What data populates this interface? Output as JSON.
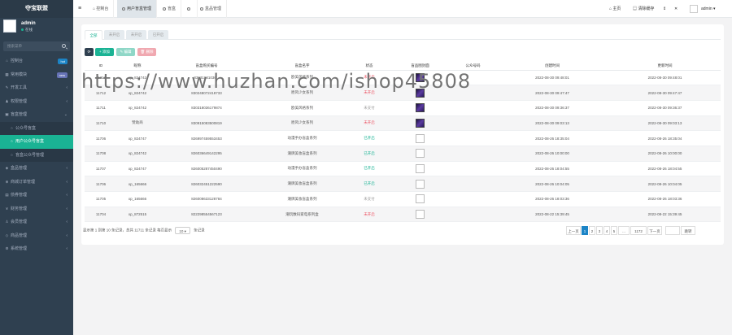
{
  "app": {
    "logo": "夺宝联盟"
  },
  "user": {
    "name": "admin",
    "status": "在线"
  },
  "search": {
    "placeholder": "搜索菜单"
  },
  "sidebar": {
    "items": [
      {
        "label": "控制台",
        "icon": "home-icon",
        "badge": "hot",
        "badge_color": "#1c84c6"
      },
      {
        "label": "常用模块",
        "icon": "table-icon",
        "badge": "new",
        "badge_color": "#6673b6"
      },
      {
        "label": "开发工具",
        "icon": "tool-icon"
      },
      {
        "label": "权限管理",
        "icon": "users-icon"
      },
      {
        "label": "盲盒管理",
        "icon": "box-icon"
      },
      {
        "label": "公众号盲盒",
        "sub": true
      },
      {
        "label": "用户公众号盲盒",
        "sub": true,
        "active": true
      },
      {
        "label": "盲盒公众号管理",
        "sub": true
      },
      {
        "label": "盒品管理",
        "icon": "cube-icon"
      },
      {
        "label": "商城订单管理",
        "icon": "cart-icon"
      },
      {
        "label": "债券管理",
        "icon": "doc-icon"
      },
      {
        "label": "财务管理",
        "icon": "money-icon"
      },
      {
        "label": "会员管理",
        "icon": "user-icon"
      },
      {
        "label": "商品管理",
        "icon": "tag-icon"
      },
      {
        "label": "系统管理",
        "icon": "gear-icon"
      }
    ]
  },
  "topbar": {
    "tabs": [
      "控制台",
      "用户盲盒管理",
      "盲盒",
      "",
      "盒品管理"
    ],
    "right": {
      "home": "主页",
      "clear_cache": "清除缓存",
      "user": "admin"
    }
  },
  "filters": {
    "tabs": [
      "全部",
      "未开启",
      "未开启",
      "已开启"
    ]
  },
  "toolbar": {
    "refresh": "⟳",
    "add": "+ 添加",
    "edit": "✎ 编辑",
    "delete": "🗑 删除"
  },
  "table": {
    "columns": [
      "ID",
      "昵称",
      "盲盒购买编号",
      "盲盒名字",
      "状态",
      "盲品图封面",
      "公众号码",
      "创建时间",
      "更新时间"
    ],
    "rows": [
      {
        "id": "11713",
        "nick": "xp_824742",
        "code": "83031881036...",
        "name": "欧美风格系列",
        "status": "未开启",
        "sc": "red",
        "img": "img",
        "num": "",
        "created": "2022-08-30 09:48:01",
        "updated": "2022-08-30 09:48:01"
      },
      {
        "id": "11712",
        "nick": "xp_824742",
        "code": "830248072418733",
        "name": "原风少女系列",
        "status": "未开启",
        "sc": "red",
        "img": "img",
        "num": "",
        "created": "2022-08-30 09:47:47",
        "updated": "2022-08-30 09:47:47"
      },
      {
        "id": "11711",
        "nick": "xp_824742",
        "code": "830318036179874",
        "name": "欧美风格系列",
        "status": "未支付",
        "sc": "gray",
        "img": "img",
        "num": "",
        "created": "2022-08-30 09:36:37",
        "updated": "2022-08-30 09:36:37"
      },
      {
        "id": "11710",
        "nick": "赞助商",
        "code": "830915083500819",
        "name": "原风少女系列",
        "status": "未开启",
        "sc": "red",
        "img": "img",
        "num": "",
        "created": "2022-08-30 09:03:13",
        "updated": "2022-08-30 09:03:13"
      },
      {
        "id": "11706",
        "nick": "xp_824747",
        "code": "826997459553453",
        "name": "动漫手办盲盒系列",
        "status": "已开启",
        "sc": "green",
        "img": "broken",
        "num": "",
        "created": "2022-08-26 18:35:04",
        "updated": "2022-08-26 18:35:04"
      },
      {
        "id": "11708",
        "nick": "xp_824742",
        "code": "826036649142295",
        "name": "潮牌美妆盲盒系列",
        "status": "已开启",
        "sc": "green",
        "img": "broken",
        "num": "",
        "created": "2022-08-26 10:00:00",
        "updated": "2022-08-26 10:00:00"
      },
      {
        "id": "11707",
        "nick": "xp_824747",
        "code": "826005287450490",
        "name": "动漫手办盲盒系列",
        "status": "已开启",
        "sc": "green",
        "img": "broken",
        "num": "",
        "created": "2022-08-26 18:04:55",
        "updated": "2022-08-26 18:04:55"
      },
      {
        "id": "11706",
        "nick": "xp_165666",
        "code": "826032451222590",
        "name": "潮牌美妆盲盒系列",
        "status": "已开启",
        "sc": "green",
        "img": "broken",
        "num": "",
        "created": "2022-08-26 10:04:05",
        "updated": "2022-08-26 10:04:05"
      },
      {
        "id": "11705",
        "nick": "xp_165666",
        "code": "826008633128784",
        "name": "潮牌美妆盲盒系列",
        "status": "未支付",
        "sc": "gray",
        "img": "broken",
        "num": "",
        "created": "2022-08-26 18:03:36",
        "updated": "2022-08-26 18:03:36"
      },
      {
        "id": "11704",
        "nick": "xp_872515",
        "code": "822298554567123",
        "name": "潮玩数码家电系列盒",
        "status": "未开启",
        "sc": "red",
        "img": "broken",
        "num": "",
        "created": "2022-08-22 15:39:45",
        "updated": "2022-08-22 15:39:45"
      }
    ]
  },
  "footer": {
    "summary": "显示第 1 到第 10 条记录，总共 11711 条记录 每页显示",
    "page_size": "10 ▾",
    "suffix": "条记录"
  },
  "pagination": [
    "上一页",
    "1",
    "2",
    "3",
    "4",
    "5",
    "...",
    "1172",
    "下一页",
    "",
    "跳转"
  ],
  "watermark": "https://www.huzhan.com/ishop45808"
}
